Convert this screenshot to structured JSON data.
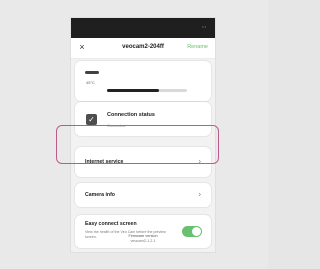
{
  "header": {
    "title": "veocam2-204ff",
    "close_label": "×",
    "rename_label": "Rename"
  },
  "temperature": {
    "value": "45°C",
    "progress_percent": 65
  },
  "connection": {
    "title": "Connection status",
    "status": "Connected",
    "icon": "check-icon"
  },
  "internet": {
    "label": "Internet service"
  },
  "camera": {
    "label": "Camera info"
  },
  "easy_connect": {
    "title": "Easy connect screen",
    "description": "View the health of the Veo Cam before the preview screen.",
    "enabled": true
  },
  "firmware": {
    "label": "Firmware version",
    "value": "veocam2-1.2.1"
  },
  "icons": {
    "chevron": "›",
    "status_signal": "••"
  },
  "colors": {
    "accent": "#67c16e",
    "highlight": "#bb5b8e"
  }
}
